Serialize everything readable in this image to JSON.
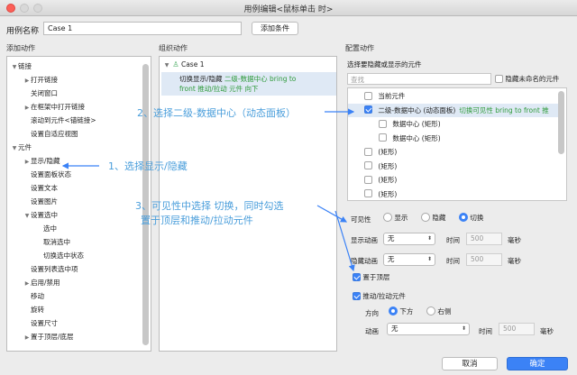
{
  "window": {
    "title": "用例编辑<鼠标单击 时>"
  },
  "header": {
    "case_name_label": "用例名称",
    "case_name_value": "Case 1",
    "add_condition": "添加条件"
  },
  "sections": {
    "add_action": "添加动作",
    "organize_action": "组织动作",
    "configure_action": "配置动作"
  },
  "left_tree": {
    "items": [
      {
        "label": "链接",
        "level": 0,
        "expanded": true
      },
      {
        "label": "打开链接",
        "level": 1,
        "expandable": true
      },
      {
        "label": "关闭窗口",
        "level": 1
      },
      {
        "label": "在框架中打开链接",
        "level": 1,
        "expandable": true
      },
      {
        "label": "滚动到元件<锚链接>",
        "level": 1
      },
      {
        "label": "设置自适应视图",
        "level": 1
      },
      {
        "label": "元件",
        "level": 0,
        "expanded": true
      },
      {
        "label": "显示/隐藏",
        "level": 1,
        "expandable": true
      },
      {
        "label": "设置面板状态",
        "level": 1
      },
      {
        "label": "设置文本",
        "level": 1
      },
      {
        "label": "设置图片",
        "level": 1
      },
      {
        "label": "设置选中",
        "level": 1,
        "expanded": true
      },
      {
        "label": "选中",
        "level": 2
      },
      {
        "label": "取消选中",
        "level": 2
      },
      {
        "label": "切换选中状态",
        "level": 2
      },
      {
        "label": "设置列表选中项",
        "level": 1
      },
      {
        "label": "启用/禁用",
        "level": 1,
        "expandable": true
      },
      {
        "label": "移动",
        "level": 1
      },
      {
        "label": "旋转",
        "level": 1
      },
      {
        "label": "设置尺寸",
        "level": 1
      },
      {
        "label": "置于顶层/底层",
        "level": 1,
        "expandable": true
      }
    ]
  },
  "middle_tree": {
    "case": "Case 1",
    "action_line1_black": "切换显示/隐藏",
    "action_line1_green": "二级-数据中心 bring to",
    "action_line2_green": "front 推动/拉动 元件 向下"
  },
  "annotations": {
    "step1": "1、选择显示/隐藏",
    "step2": "2、选择二级-数据中心（动态面板）",
    "step3_line1": "3、可见性中选择 切换，同时勾选",
    "step3_line2": "置于顶层和推动/拉动元件"
  },
  "right_panel": {
    "choose_label": "选择要隐藏或显示的元件",
    "search_placeholder": "查找",
    "hide_unnamed": "隐藏未命名的元件",
    "items": [
      {
        "label": "当前元件",
        "checked": false,
        "indent": 0
      },
      {
        "label": "二级-数据中心 (动态面板)",
        "extra": "切换可见性 bring to front 推",
        "checked": true,
        "indent": 0
      },
      {
        "label": "数据中心 (矩形)",
        "checked": false,
        "indent": 1
      },
      {
        "label": "数据中心 (矩形)",
        "checked": false,
        "indent": 1
      },
      {
        "label": "(矩形)",
        "checked": false,
        "indent": 0
      },
      {
        "label": "(矩形)",
        "checked": false,
        "indent": 0
      },
      {
        "label": "(矩形)",
        "checked": false,
        "indent": 0
      },
      {
        "label": "(矩形)",
        "checked": false,
        "indent": 0
      }
    ],
    "visibility_label": "可见性",
    "vis_show": "显示",
    "vis_hide": "隐藏",
    "vis_toggle": "切换",
    "show_anim_label": "显示动画",
    "show_anim_value": "无",
    "time_label": "时间",
    "time_value": "500",
    "ms_label": "毫秒",
    "hide_anim_label": "隐藏动画",
    "hide_anim_value": "无",
    "bring_to_top": "置于顶层",
    "push_pull": "推动/拉动元件",
    "direction_label": "方向",
    "dir_down": "下方",
    "dir_right": "右侧",
    "anim_label": "动画",
    "anim_value": "无"
  },
  "footer": {
    "cancel": "取消",
    "ok": "确定"
  },
  "colors": {
    "accent": "#3b82f6",
    "annotation": "#4a9edb",
    "green_text": "#2e9a3a"
  }
}
